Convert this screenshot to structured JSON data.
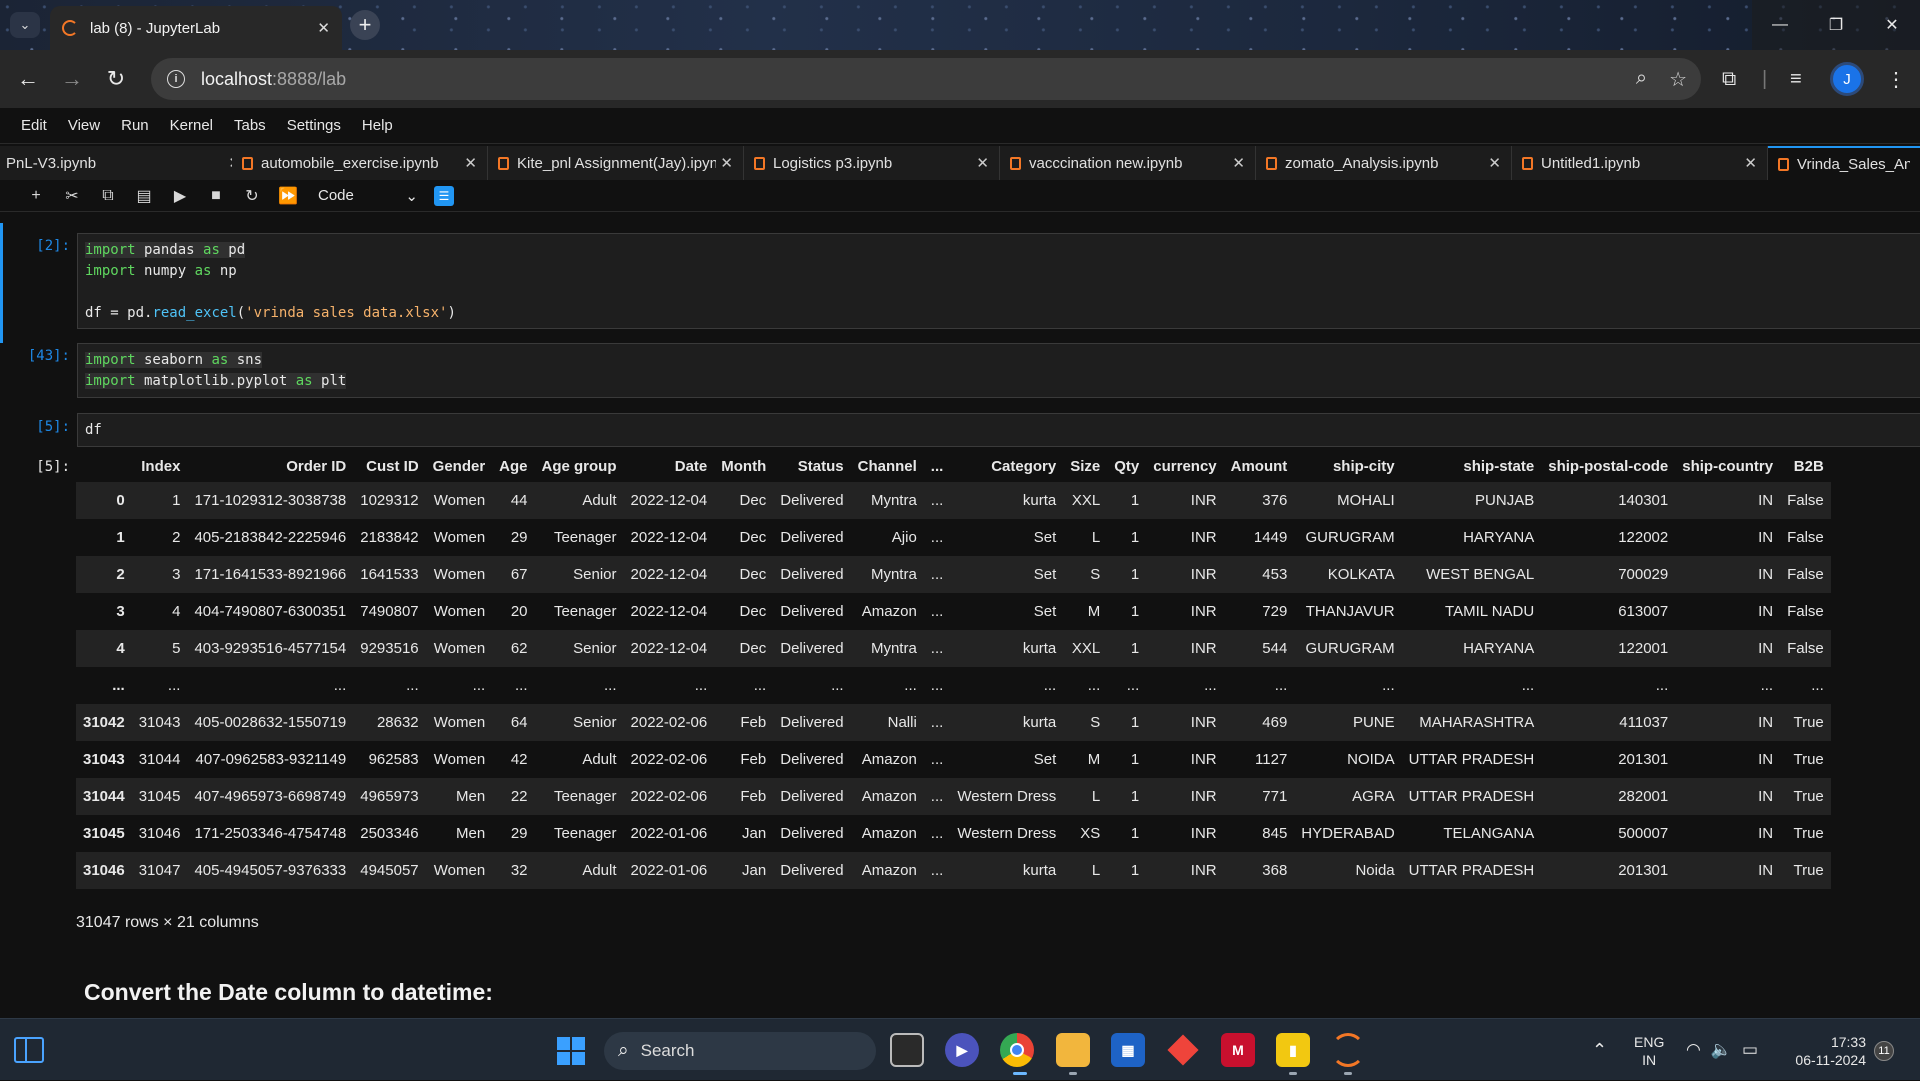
{
  "browser": {
    "tab_title": "lab (8) - JupyterLab",
    "tab_close": "✕",
    "new_tab": "+",
    "url_host": "localhost",
    "url_path": ":8888/lab",
    "profile_initial": "J"
  },
  "menu": [
    "Edit",
    "View",
    "Run",
    "Kernel",
    "Tabs",
    "Settings",
    "Help"
  ],
  "notebook_tabs": [
    "PnL-V3.ipynb",
    "automobile_exercise.ipynb",
    "Kite_pnl Assignment(Jay).ipynb",
    "Logistics p3.ipynb",
    "vacccination new.ipynb",
    "zomato_Analysis.ipynb",
    "Untitled1.ipynb",
    "Vrinda_Sales_Anal"
  ],
  "toolbar": {
    "cell_type": "Code"
  },
  "cells": {
    "c1_prompt": "[2]:",
    "c2_prompt": "[43]:",
    "c3_prompt": "[5]:",
    "out_prompt": "[5]:",
    "c3_code": "df"
  },
  "dataframe": {
    "columns": [
      "",
      "Index",
      "Order ID",
      "Cust ID",
      "Gender",
      "Age",
      "Age group",
      "Date",
      "Month",
      "Status",
      "Channel",
      "...",
      "Category",
      "Size",
      "Qty",
      "currency",
      "Amount",
      "ship-city",
      "ship-state",
      "ship-postal-code",
      "ship-country",
      "B2B"
    ],
    "rows": [
      [
        "0",
        "1",
        "171-1029312-3038738",
        "1029312",
        "Women",
        "44",
        "Adult",
        "2022-12-04",
        "Dec",
        "Delivered",
        "Myntra",
        "...",
        "kurta",
        "XXL",
        "1",
        "INR",
        "376",
        "MOHALI",
        "PUNJAB",
        "140301",
        "IN",
        "False"
      ],
      [
        "1",
        "2",
        "405-2183842-2225946",
        "2183842",
        "Women",
        "29",
        "Teenager",
        "2022-12-04",
        "Dec",
        "Delivered",
        "Ajio",
        "...",
        "Set",
        "L",
        "1",
        "INR",
        "1449",
        "GURUGRAM",
        "HARYANA",
        "122002",
        "IN",
        "False"
      ],
      [
        "2",
        "3",
        "171-1641533-8921966",
        "1641533",
        "Women",
        "67",
        "Senior",
        "2022-12-04",
        "Dec",
        "Delivered",
        "Myntra",
        "...",
        "Set",
        "S",
        "1",
        "INR",
        "453",
        "KOLKATA",
        "WEST BENGAL",
        "700029",
        "IN",
        "False"
      ],
      [
        "3",
        "4",
        "404-7490807-6300351",
        "7490807",
        "Women",
        "20",
        "Teenager",
        "2022-12-04",
        "Dec",
        "Delivered",
        "Amazon",
        "...",
        "Set",
        "M",
        "1",
        "INR",
        "729",
        "THANJAVUR",
        "TAMIL NADU",
        "613007",
        "IN",
        "False"
      ],
      [
        "4",
        "5",
        "403-9293516-4577154",
        "9293516",
        "Women",
        "62",
        "Senior",
        "2022-12-04",
        "Dec",
        "Delivered",
        "Myntra",
        "...",
        "kurta",
        "XXL",
        "1",
        "INR",
        "544",
        "GURUGRAM",
        "HARYANA",
        "122001",
        "IN",
        "False"
      ],
      [
        "...",
        "...",
        "...",
        "...",
        "...",
        "...",
        "...",
        "...",
        "...",
        "...",
        "...",
        "...",
        "...",
        "...",
        "...",
        "...",
        "...",
        "...",
        "...",
        "...",
        "...",
        "..."
      ],
      [
        "31042",
        "31043",
        "405-0028632-1550719",
        "28632",
        "Women",
        "64",
        "Senior",
        "2022-02-06",
        "Feb",
        "Delivered",
        "Nalli",
        "...",
        "kurta",
        "S",
        "1",
        "INR",
        "469",
        "PUNE",
        "MAHARASHTRA",
        "411037",
        "IN",
        "True"
      ],
      [
        "31043",
        "31044",
        "407-0962583-9321149",
        "962583",
        "Women",
        "42",
        "Adult",
        "2022-02-06",
        "Feb",
        "Delivered",
        "Amazon",
        "...",
        "Set",
        "M",
        "1",
        "INR",
        "1127",
        "NOIDA",
        "UTTAR PRADESH",
        "201301",
        "IN",
        "True"
      ],
      [
        "31044",
        "31045",
        "407-4965973-6698749",
        "4965973",
        "Men",
        "22",
        "Teenager",
        "2022-02-06",
        "Feb",
        "Delivered",
        "Amazon",
        "...",
        "Western Dress",
        "L",
        "1",
        "INR",
        "771",
        "AGRA",
        "UTTAR PRADESH",
        "282001",
        "IN",
        "True"
      ],
      [
        "31045",
        "31046",
        "171-2503346-4754748",
        "2503346",
        "Men",
        "29",
        "Teenager",
        "2022-01-06",
        "Jan",
        "Delivered",
        "Amazon",
        "...",
        "Western Dress",
        "XS",
        "1",
        "INR",
        "845",
        "HYDERABAD",
        "TELANGANA",
        "500007",
        "IN",
        "True"
      ],
      [
        "31046",
        "31047",
        "405-4945057-9376333",
        "4945057",
        "Women",
        "32",
        "Adult",
        "2022-01-06",
        "Jan",
        "Delivered",
        "Amazon",
        "...",
        "kurta",
        "L",
        "1",
        "INR",
        "368",
        "Noida",
        "UTTAR PRADESH",
        "201301",
        "IN",
        "True"
      ]
    ],
    "shape_text": "31047 rows × 21 columns"
  },
  "markdown_heading": "Convert the Date column to datetime:",
  "taskbar": {
    "search_label": "Search",
    "lang_line1": "ENG",
    "lang_line2": "IN",
    "time": "17:33",
    "date": "06-11-2024",
    "notif_count": "11"
  },
  "colors": {
    "accent": "#2196f3",
    "jupyter_orange": "#f37726",
    "keyword_green": "#5fd75f",
    "string_orange": "#f6b26b"
  }
}
